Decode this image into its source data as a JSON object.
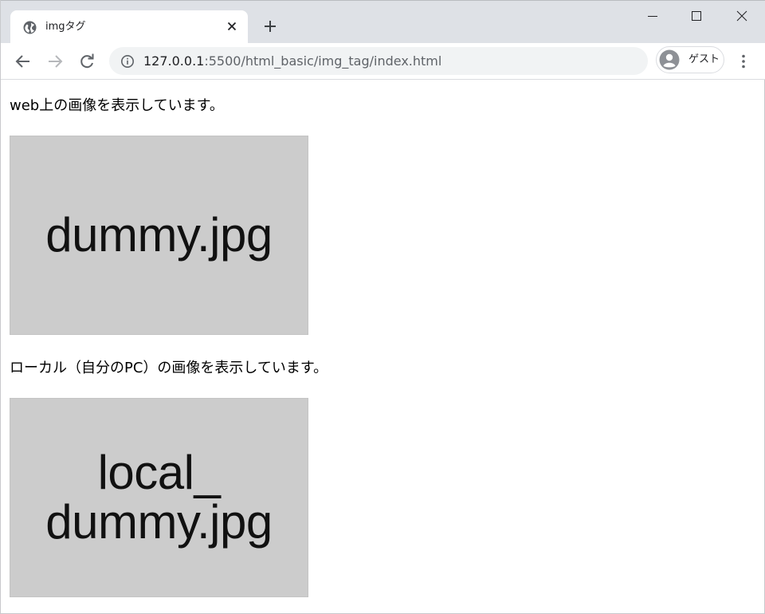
{
  "browser": {
    "tab": {
      "title": "imgタグ",
      "favicon": "globe-icon"
    },
    "new_tab_icon": "plus-icon",
    "window_controls": [
      "minimize-icon",
      "maximize-icon",
      "close-icon"
    ],
    "toolbar": {
      "back_icon": "arrow-left-icon",
      "forward_icon": "arrow-right-icon",
      "reload_icon": "reload-icon",
      "url_host": "127.0.0.1",
      "url_rest": ":5500/html_basic/img_tag/index.html",
      "profile_label": "ゲスト",
      "menu_icon": "kebab-menu-icon"
    }
  },
  "page": {
    "para1": "web上の画像を表示しています。",
    "image1_text": "dummy.jpg",
    "para2": "ローカル（自分のPC）の画像を表示しています。",
    "image2_line1": "local_",
    "image2_line2": "dummy.jpg"
  },
  "colors": {
    "tabstrip": "#dee1e6",
    "omnibox": "#f1f3f4",
    "image_placeholder": "#cccccc"
  }
}
